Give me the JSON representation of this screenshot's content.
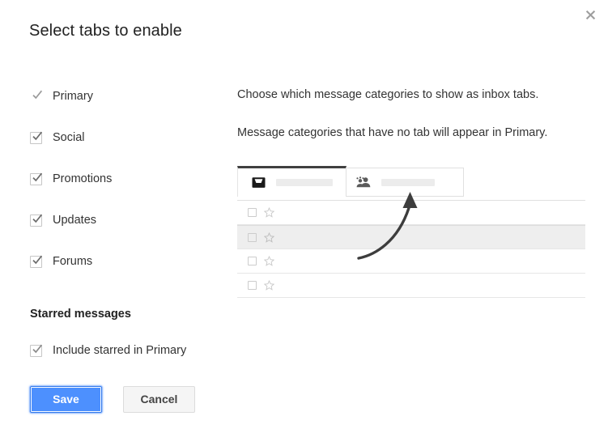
{
  "dialog": {
    "title": "Select tabs to enable",
    "close_icon": "close-icon"
  },
  "tabs_checkboxes": [
    {
      "label": "Primary",
      "checked": true,
      "disabled": true
    },
    {
      "label": "Social",
      "checked": true,
      "disabled": false
    },
    {
      "label": "Promotions",
      "checked": true,
      "disabled": false
    },
    {
      "label": "Updates",
      "checked": true,
      "disabled": false
    },
    {
      "label": "Forums",
      "checked": true,
      "disabled": false
    }
  ],
  "starred": {
    "heading": "Starred messages",
    "checkbox_label": "Include starred in Primary",
    "checked": true
  },
  "buttons": {
    "save_label": "Save",
    "cancel_label": "Cancel",
    "save_bg": "#4d90fe",
    "save_border": "#3079ed",
    "cancel_bg": "#f5f5f5"
  },
  "description": {
    "line1": "Choose which message categories to show as inbox tabs.",
    "line2": "Message categories that have no tab will appear in Primary."
  },
  "mockup": {
    "tabs": [
      {
        "icon": "inbox-icon",
        "name": "primary-tab",
        "active": true
      },
      {
        "icon": "people-icon",
        "name": "social-tab",
        "active": false
      }
    ],
    "rows": [
      {
        "highlight": false
      },
      {
        "highlight": true
      },
      {
        "highlight": false
      },
      {
        "highlight": false
      }
    ],
    "annotation_icon": "curved-arrow-icon",
    "active_tab_indicator_color": "#404040",
    "row_highlight_color": "#eeeeee"
  }
}
